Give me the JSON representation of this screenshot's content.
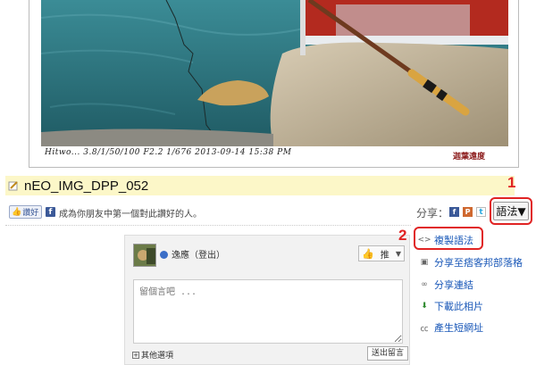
{
  "photo": {
    "exif": "Hitwo... 3.8/1/50/100 F2.2 1/676 2013-09-14 15:38 PM",
    "signature": "迦葉遠度"
  },
  "title": "nEO_IMG_DPP_052",
  "like": {
    "button_label": "讚好",
    "prompt": "成為你朋友中第一個對此讚好的人。"
  },
  "share": {
    "label": "分享：",
    "fb": "f",
    "plurk": "P",
    "twitter": "t",
    "syntax_label": "語法▼"
  },
  "annotations": {
    "num1": "1",
    "num2": "2"
  },
  "comment": {
    "username": "逸應（登出）",
    "push_label": "推",
    "placeholder": "留個言吧 ...",
    "more_options": "其他選項",
    "send_label": "送出留言"
  },
  "menu": {
    "items": [
      {
        "label": "複製語法",
        "icon": "code-icon"
      },
      {
        "label": "分享至痞客邦部落格",
        "icon": "blog-icon"
      },
      {
        "label": "分享連結",
        "icon": "link-icon"
      },
      {
        "label": "下載此相片",
        "icon": "download-icon"
      },
      {
        "label": "產生短網址",
        "icon": "short-url-icon"
      }
    ]
  },
  "colors": {
    "annotation_red": "#e02323",
    "link_blue": "#1a58b8",
    "title_bg": "#fcf7c8",
    "facebook_blue": "#3b5998"
  }
}
